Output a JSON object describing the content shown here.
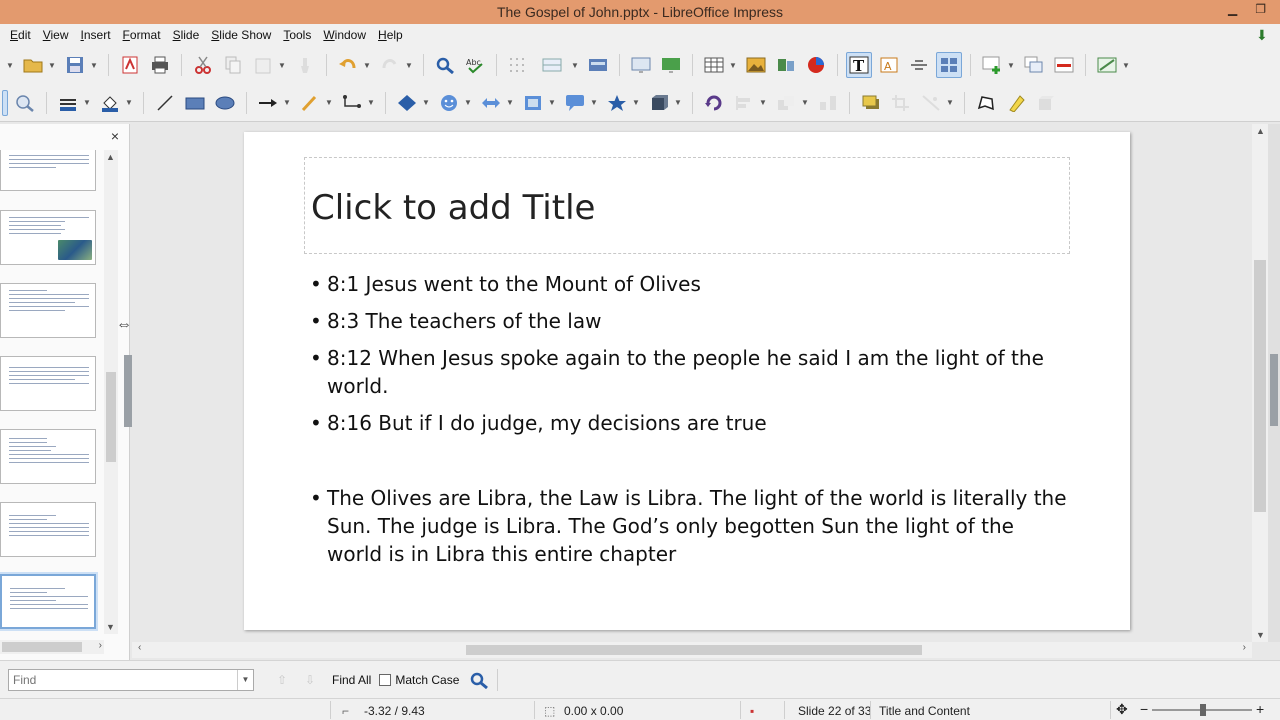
{
  "window": {
    "title": "The Gospel of John.pptx - LibreOffice Impress",
    "minimize": "▁",
    "restore": "❐"
  },
  "menu": [
    "Edit",
    "View",
    "Insert",
    "Format",
    "Slide",
    "Slide Show",
    "Tools",
    "Window",
    "Help"
  ],
  "slide_panel": {
    "close": "×",
    "thumb_count_visible": 7
  },
  "slide": {
    "title_placeholder": "Click to add Title",
    "bullets": [
      "8:1 Jesus went to the Mount of Olives",
      "8:3 The teachers of the law",
      "8:12 When Jesus spoke again to the people he said I am the light of the world.",
      "8:16 But if I do judge, my decisions are true"
    ],
    "bullets_after_gap": [
      "The Olives are Libra, the Law is Libra. The light of the world is literally the Sun. The judge is Libra.  The God’s only begotten Sun the light of the world is in Libra this entire chapter"
    ]
  },
  "findbar": {
    "placeholder": "Find",
    "find_all": "Find All",
    "match_case": "Match Case"
  },
  "status": {
    "position": "-3.32 / 9.43",
    "size": "0.00 x 0.00",
    "slide": "Slide 22 of 33",
    "layout": "Title and Content"
  }
}
